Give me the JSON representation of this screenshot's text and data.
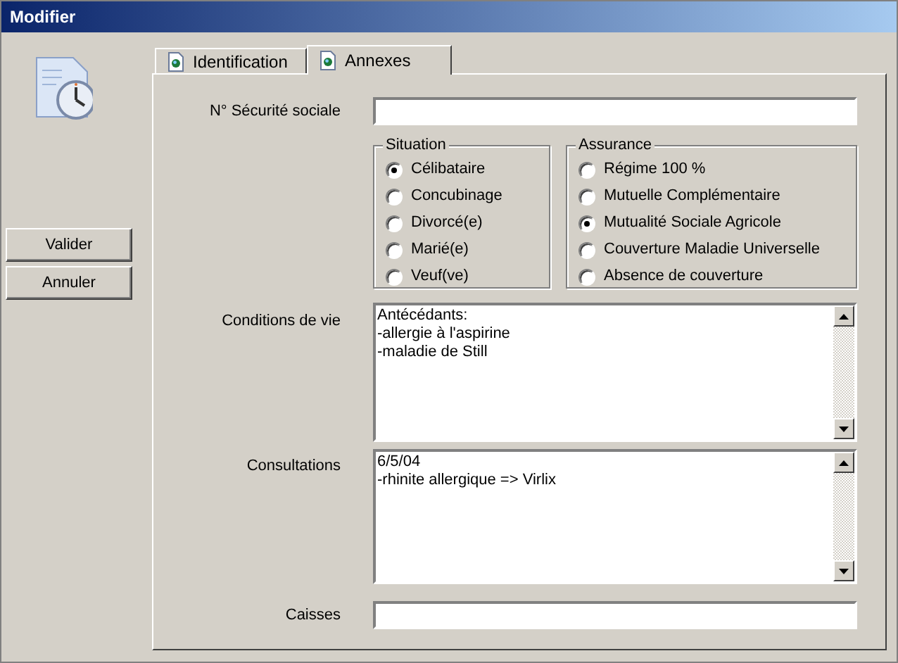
{
  "window": {
    "title": "Modifier"
  },
  "buttons": [
    "Valider",
    "Annuler"
  ],
  "tabs": [
    {
      "label": "Identification",
      "selected": false
    },
    {
      "label": "Annexes",
      "selected": true
    }
  ],
  "secu": {
    "label": "N° Sécurité sociale"
  },
  "groups": [
    {
      "title": "Situation",
      "options": [
        {
          "label": "Célibataire",
          "selected": true
        },
        {
          "label": "Concubinage",
          "selected": false
        },
        {
          "label": "Divorcé(e)",
          "selected": false
        },
        {
          "label": "Marié(e)",
          "selected": false
        },
        {
          "label": "Veuf(ve)",
          "selected": false
        }
      ]
    },
    {
      "title": "Assurance",
      "options": [
        {
          "label": "Régime 100 %",
          "selected": false
        },
        {
          "label": "Mutuelle Complémentaire",
          "selected": false
        },
        {
          "label": "Mutualité Sociale Agricole",
          "selected": true
        },
        {
          "label": "Couverture Maladie Universelle",
          "selected": false
        },
        {
          "label": "Absence de couverture",
          "selected": false
        }
      ]
    }
  ],
  "conditions": {
    "label": "Conditions de vie",
    "value": "Antécédants:\n-allergie à l'aspirine\n-maladie de Still"
  },
  "consultations": {
    "label": "Consultations",
    "value": "6/5/04\n-rhinite allergique => Virlix"
  },
  "caisses": {
    "label": "Caisses"
  }
}
